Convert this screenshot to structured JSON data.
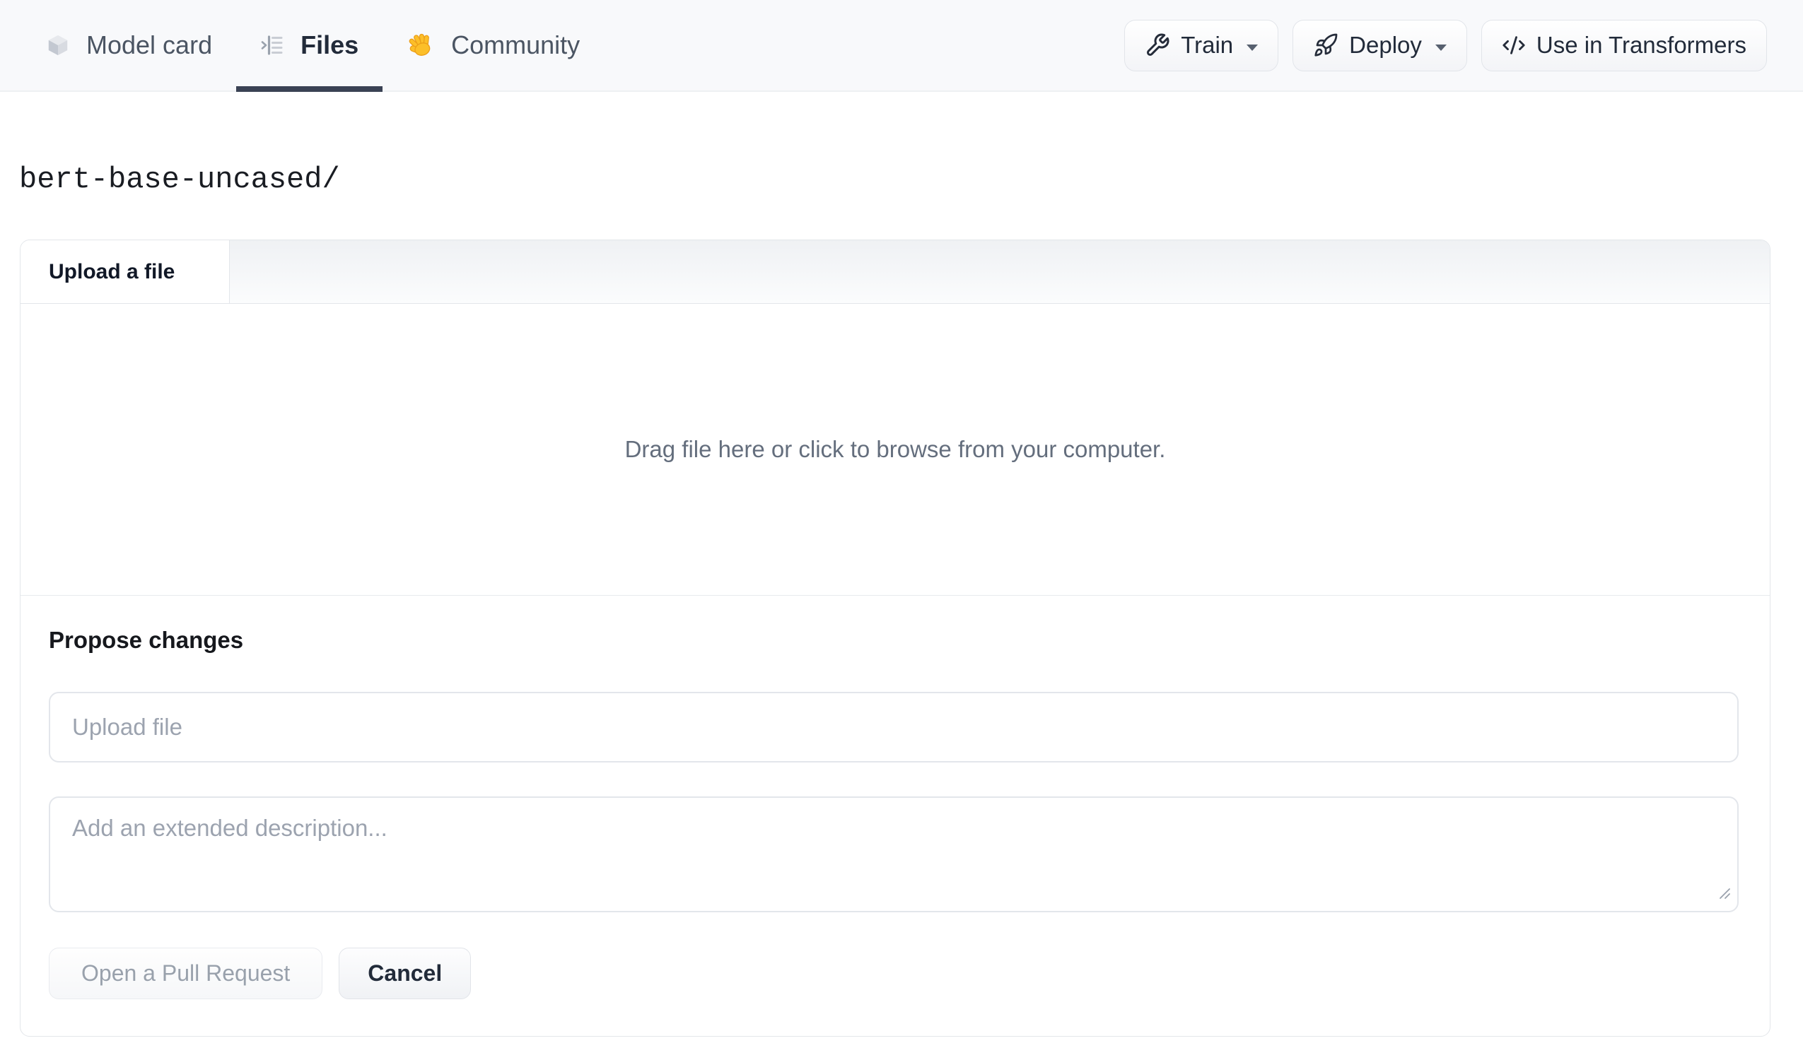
{
  "header": {
    "tabs": [
      {
        "label": "Model card",
        "icon": "cube-icon",
        "active": false
      },
      {
        "label": "Files",
        "icon": "files-list-icon",
        "active": true
      },
      {
        "label": "Community",
        "icon": "wave-hand-icon",
        "active": false
      }
    ],
    "actions": [
      {
        "label": "Train",
        "icon": "wrench-icon",
        "dropdown": true
      },
      {
        "label": "Deploy",
        "icon": "rocket-icon",
        "dropdown": true
      },
      {
        "label": "Use in Transformers",
        "icon": "code-icon",
        "dropdown": false
      }
    ]
  },
  "breadcrumb": {
    "path": "bert-base-uncased/"
  },
  "upload_card": {
    "tab_label": "Upload a file",
    "dropzone_text": "Drag file here or click to browse from your computer.",
    "propose": {
      "heading": "Propose changes",
      "file_input_placeholder": "Upload file",
      "description_placeholder": "Add an extended description...",
      "open_pr_label": "Open a Pull Request",
      "cancel_label": "Cancel"
    }
  },
  "colors": {
    "header_bg": "#f8f9fb",
    "active_tab_underline": "#3a4254",
    "nav_text": "#4b5563",
    "nav_text_active": "#222b3a",
    "dropzone_text": "#646e7d",
    "placeholder_text": "#9ca3af",
    "card_border": "#e3e6ea",
    "disabled_button_text": "#99a1ac",
    "wave_hand_yellow": "#fcbf29"
  }
}
